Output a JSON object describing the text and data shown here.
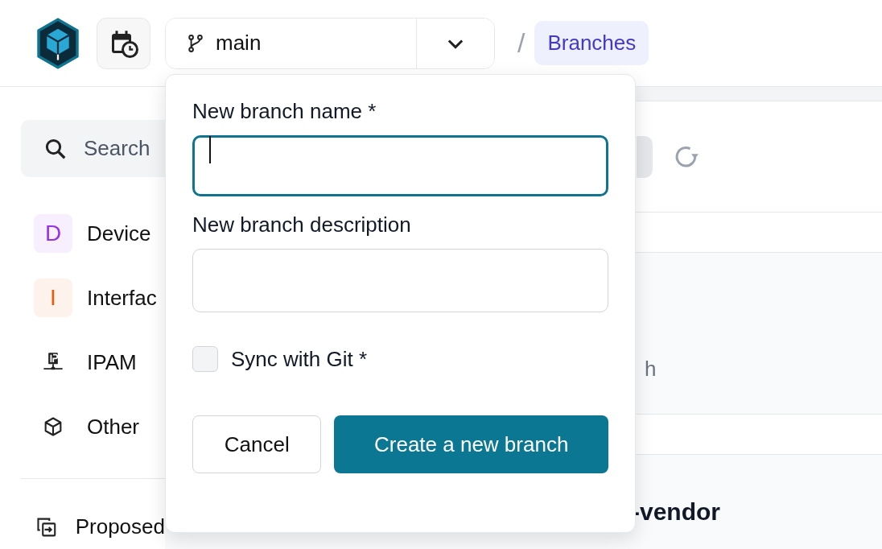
{
  "header": {
    "branch_selector": {
      "value": "main"
    },
    "breadcrumb": {
      "separator": "/",
      "current": "Branches"
    }
  },
  "sidebar": {
    "search": {
      "placeholder": "Search"
    },
    "items": [
      {
        "label": "Device",
        "kind": "letter",
        "letter": "D",
        "color": "#9333ea"
      },
      {
        "label": "Interfac",
        "kind": "letter",
        "letter": "I",
        "color": "#ea580c"
      },
      {
        "label": "IPAM",
        "kind": "ipam"
      },
      {
        "label": "Other",
        "kind": "cube"
      }
    ],
    "footer_items": [
      {
        "label": "Proposed"
      }
    ]
  },
  "main": {
    "search_fragment": "h",
    "row_title_fragment": "-vendor"
  },
  "popover": {
    "fields": [
      {
        "label": "New branch name *",
        "focused": true
      },
      {
        "label": "New branch description",
        "focused": false
      }
    ],
    "checkbox": {
      "label": "Sync with Git *",
      "checked": false
    },
    "buttons": [
      {
        "label": "Cancel",
        "kind": "secondary"
      },
      {
        "label": "Create a new branch",
        "kind": "primary"
      }
    ]
  }
}
